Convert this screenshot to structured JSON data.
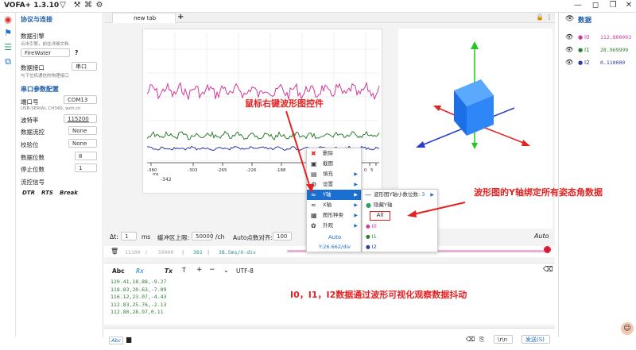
{
  "app": {
    "title": "VOFA+ 1.3.10"
  },
  "colors": {
    "accent": "#1a6fd0",
    "annotation": "#e52222",
    "rx_text": "#2e7d32",
    "i0": "#d1389a",
    "i1": "#2e7d32",
    "i2": "#2a3aa0"
  },
  "left": {
    "section_protocol": "协议与连接",
    "engine_label": "数据引擎",
    "engine_sub": "点击引擎，前往详细文档",
    "engine_value": "FireWater",
    "engine_help": "?",
    "iface_label": "数据接口",
    "iface_sub": "与下位机通信的物理接口",
    "iface_value": "串口",
    "section_serial": "串口参数配置",
    "port_label": "端口号",
    "port_value": "COM13",
    "port_sub": "USB-SERIAL CH340, wch.cn",
    "baud_label": "波特率",
    "baud_value": "115200",
    "flow_label": "数据流控",
    "flow_value": "None",
    "parity_label": "校验位",
    "parity_value": "None",
    "databits_label": "数据位数",
    "databits_value": "8",
    "stopbits_label": "停止位数",
    "stopbits_value": "1",
    "signal_label": "流控信号",
    "dtr": "DTR",
    "rts": "RTS",
    "brk": "Break"
  },
  "tabs": {
    "tab1": "new tab",
    "add": "+"
  },
  "plot": {
    "xticks_top": [
      "-380",
      "-303",
      "-265",
      "-226",
      "-188",
      "-149",
      "-111",
      "0",
      "5"
    ],
    "xticks_bottom": [
      "-342"
    ],
    "ms": "ms"
  },
  "ctrl": {
    "dt_label": "Δt:",
    "dt_value": "1",
    "dt_unit": "ms",
    "buf_label": "缓冲区上限:",
    "buf_value": "50000",
    "buf_unit": "/ch",
    "auto_label": "Auto点数对齐:",
    "auto_value": "100",
    "auto_right": "Auto"
  },
  "seek": {
    "v1": "11100",
    "v2": "50000",
    "v3": "381",
    "v4": "38.5ms/X-div"
  },
  "tb2": {
    "abc": "Abc",
    "rx": "Rx",
    "tx": "Tx",
    "encoding": "UTF-8"
  },
  "rx_lines": [
    "120.41,18.88,-9.27",
    "118.83,20.63,-7.09",
    "116.12,23.07,-4.43",
    "112.83,25.76,-2.13",
    "112.80,28.97,0.11"
  ],
  "bottom": {
    "abc": "Abc",
    "crlf": "\\r\\n",
    "send": "发送(S)"
  },
  "right": {
    "title": "数据",
    "channels": [
      {
        "name": "I0",
        "value": "112.800003"
      },
      {
        "name": "I1",
        "value": "28.969999"
      },
      {
        "name": "I2",
        "value": "0.110000"
      }
    ]
  },
  "menu": {
    "items": [
      "删除",
      "截图",
      "填充",
      "设置",
      "Y轴",
      "X轴",
      "图形种类",
      "外观"
    ],
    "auto": "Auto",
    "ydiv": "Y:26.662/div"
  },
  "submenu": {
    "decimals_label": "波形图Y轴小数位数:",
    "decimals_value": "3",
    "hide_y": "隐藏Y轴",
    "all": "All",
    "ch": [
      "I0",
      "I1",
      "I2"
    ]
  },
  "annotations": {
    "a1": "鼠标右键波形图控件",
    "a2": "波形图的Y轴绑定所有姿态角数据",
    "a3": "I0，I1，I2数据通过波形可视化观察数据抖动"
  }
}
